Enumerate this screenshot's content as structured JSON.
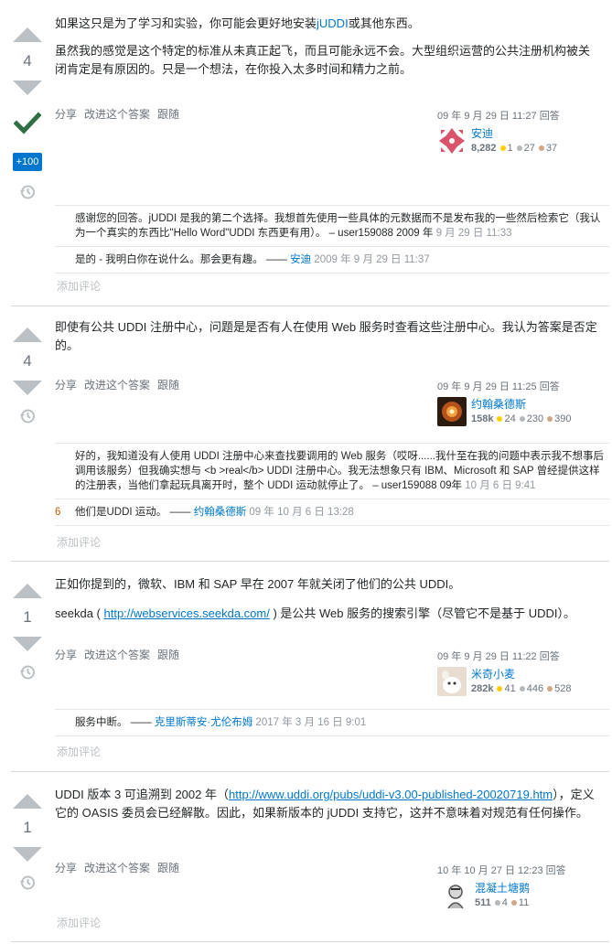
{
  "menu": {
    "share": "分享",
    "improve": "改进这个答案",
    "follow": "跟随"
  },
  "add_comment": "添加评论",
  "answers": [
    {
      "votes": "4",
      "accepted": true,
      "bounty": "+100",
      "paragraphs": [
        {
          "pre": "如果这只是为了学习和实验，你可能会更好地安装",
          "link": "jUDDI",
          "post": "或其他东西。"
        },
        {
          "pre": "虽然我的感觉是这个特定的标准从未真正起飞，而且可能永远不会。大型组织运营的公共注册机构被关闭肯定是有原因的。只是一个想法，在你投入太多时间和精力之前。",
          "link": "",
          "post": ""
        }
      ],
      "answered": "09 年 9 月 29 日 11:27 回答",
      "user": {
        "name": "安迪",
        "rep": "8,282",
        "gold": "1",
        "silver": "27",
        "bronze": "37"
      },
      "comments": [
        {
          "score": "",
          "text": "感谢您的回答。jUDDI 是我的第二个选择。我想首先使用一些具体的元数据而不是发布我的一些然后检索它（我认为一个真实的东西比\"Hello Word\"UDDI 东西更有用）。 –  user159088 2009 年 ",
          "date": "9 月 29 日 11:33",
          "user": ""
        },
        {
          "score": "",
          "text": "是的 - 我明白你在说什么。那会更有趣。 —— ",
          "user": "安迪",
          "date": " 2009 年 9 月 29 日 11:37"
        }
      ]
    },
    {
      "votes": "4",
      "accepted": false,
      "bounty": "",
      "paragraphs": [
        {
          "pre": "即使有公共 UDDI 注册中心，问题是是否有人在使用 Web 服务时查看这些注册中心。我认为答案是否定的。",
          "link": "",
          "post": ""
        }
      ],
      "answered": "09 年 9 月 29 日 11:25 回答",
      "user": {
        "name": "约翰桑德斯",
        "rep": "158k",
        "gold": "24",
        "silver": "230",
        "bronze": "390"
      },
      "comments": [
        {
          "score": "",
          "text": "好的，我知道没有人使用 UDDI 注册中心来查找要调用的 Web 服务（哎呀......我什至在我的问题中表示我不想事后调用该服务）但我确实想与 <b >real</b> UDDI 注册中心。我无法想象只有 IBM、Microsoft 和 SAP 曾经提供这样的注册表，当他们拿起玩具离开时，整个 UDDI 运动就停止了。 – user159088 09年 ",
          "date": "10 月 6 日 9:41",
          "user": ""
        },
        {
          "score": "6",
          "text": "他们是UDDI 运动。 —— ",
          "user": "约翰桑德斯",
          "date": " 09 年 10 月 6 日 13:28"
        }
      ]
    },
    {
      "votes": "1",
      "accepted": false,
      "bounty": "",
      "paragraphs": [
        {
          "pre": "正如你提到的，微软、IBM 和 SAP 早在 2007 年就关闭了他们的公共 UDDI。",
          "link": "",
          "post": ""
        },
        {
          "pre": "seekda ( ",
          "link": "http://webservices.seekda.com/",
          "post": " ) 是公共 Web 服务的搜索引擎（尽管它不是基于 UDDI）。"
        }
      ],
      "answered": "09 年 9 月 29 日 11:22 回答",
      "user": {
        "name": "米奇小麦",
        "rep": "282k",
        "gold": "41",
        "silver": "446",
        "bronze": "528"
      },
      "comments": [
        {
          "score": "",
          "text": "服务中断。 —— ",
          "user": "克里斯蒂安·尤伦布姆",
          "date": " 2017 年 3 月 16 日 9:01"
        }
      ]
    },
    {
      "votes": "1",
      "accepted": false,
      "bounty": "",
      "paragraphs": [
        {
          "pre": "UDDI 版本 3 可追溯到 2002 年（",
          "link": "http://www.uddi.org/pubs/uddi-v3.00-published-20020719.htm",
          "post": "），定义它的 OASIS 委员会已经解散。因此，如果新版本的 jUDDI 支持它，这并不意味着对规范有任何操作。"
        }
      ],
      "answered": "10 年 10 月 27 日 12:23 回答",
      "user": {
        "name": "混凝土塘鹅",
        "rep": "511",
        "gold": "",
        "silver": "4",
        "bronze": "11"
      },
      "comments": []
    }
  ]
}
